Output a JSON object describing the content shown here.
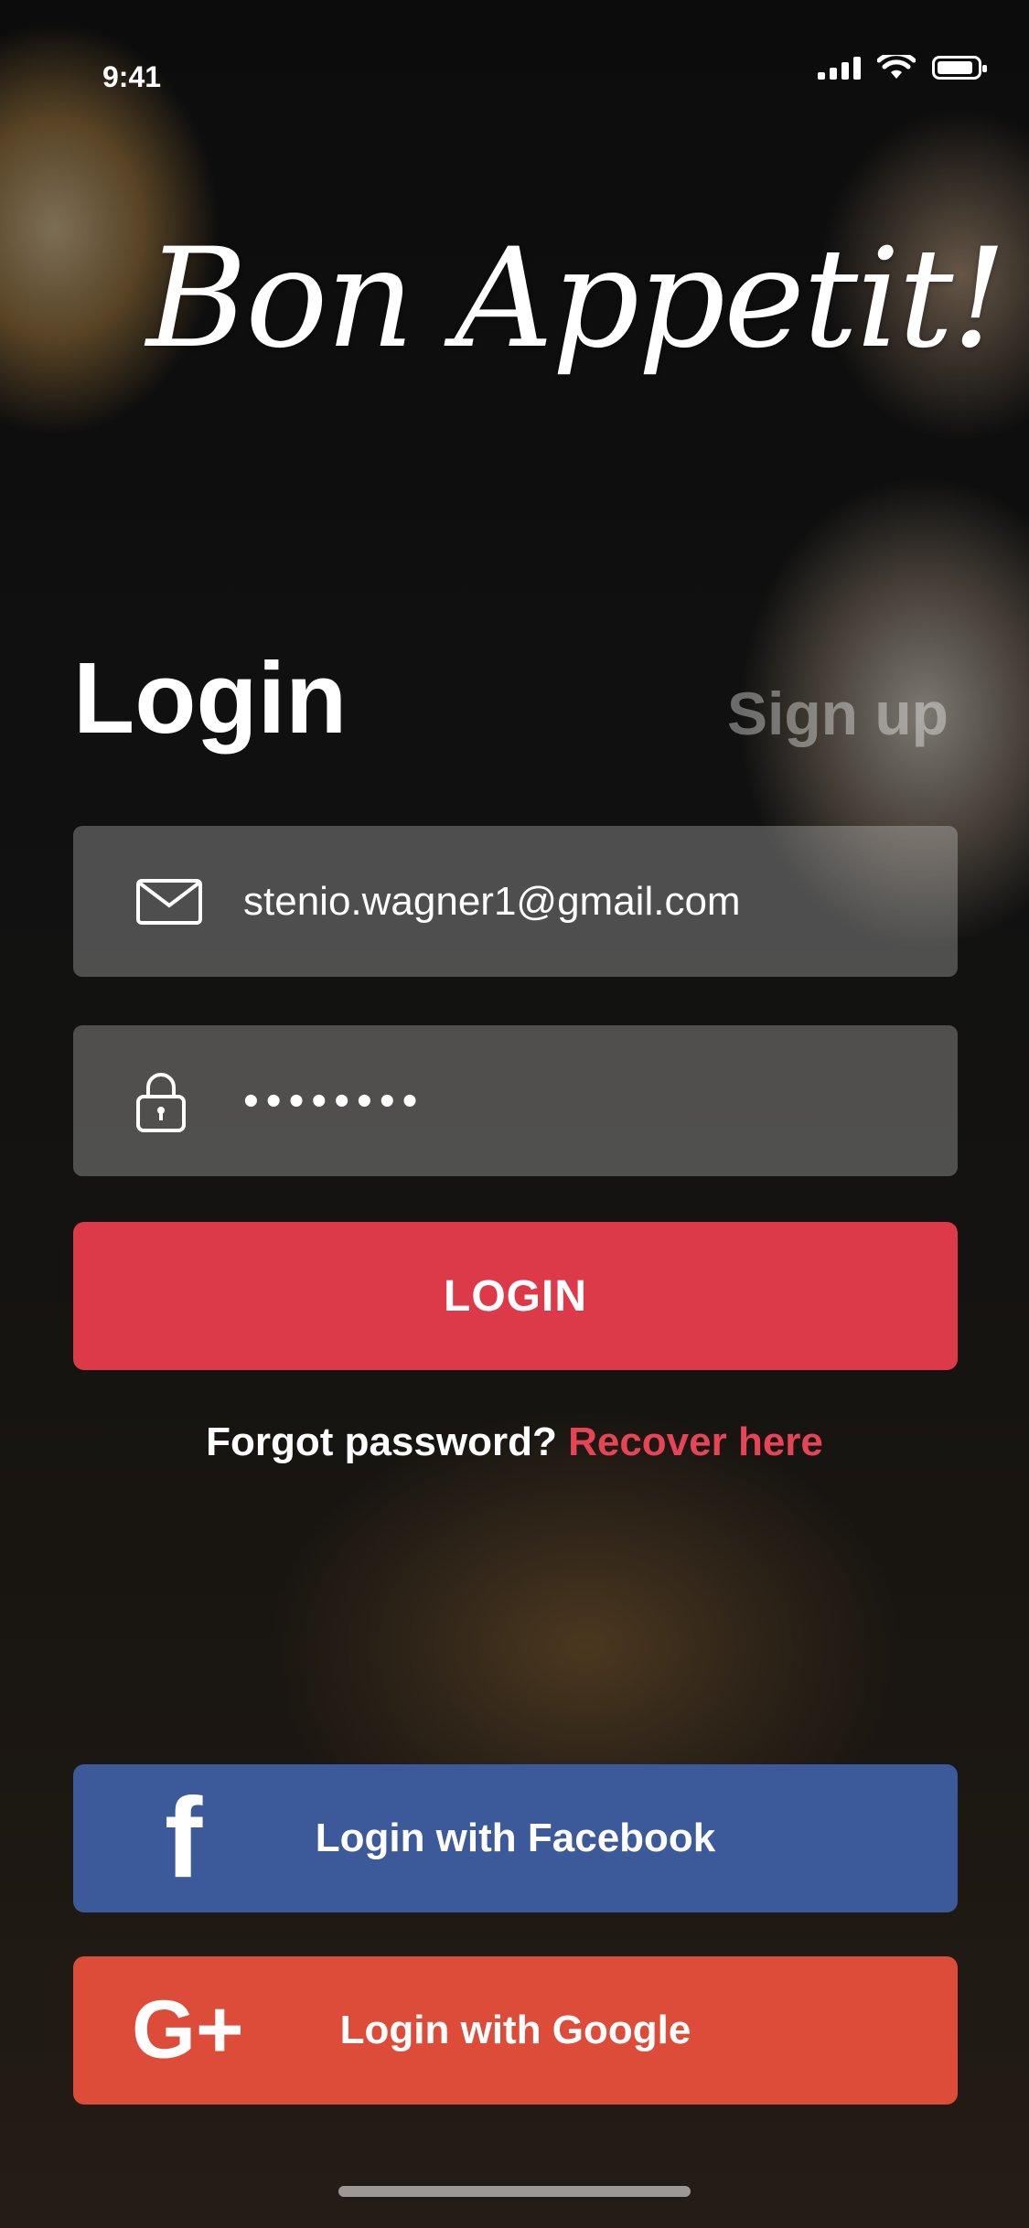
{
  "status_bar": {
    "time": "9:41",
    "icons": [
      "signal-icon",
      "wifi-icon",
      "battery-icon"
    ]
  },
  "app": {
    "logo_text": "Bon Appetit!"
  },
  "tabs": {
    "login": "Login",
    "signup": "Sign up"
  },
  "form": {
    "email_value": "stenio.wagner1@gmail.com",
    "password_value": "••••••••",
    "login_button": "LOGIN",
    "forgot_text": "Forgot password? ",
    "recover_link": "Recover here"
  },
  "social": {
    "facebook_label": "Login with Facebook",
    "google_label": "Login with Google"
  },
  "colors": {
    "accent": "#dd3a49",
    "facebook": "#3c5a99",
    "google": "#dd4b39",
    "recover_link": "#e74455"
  }
}
